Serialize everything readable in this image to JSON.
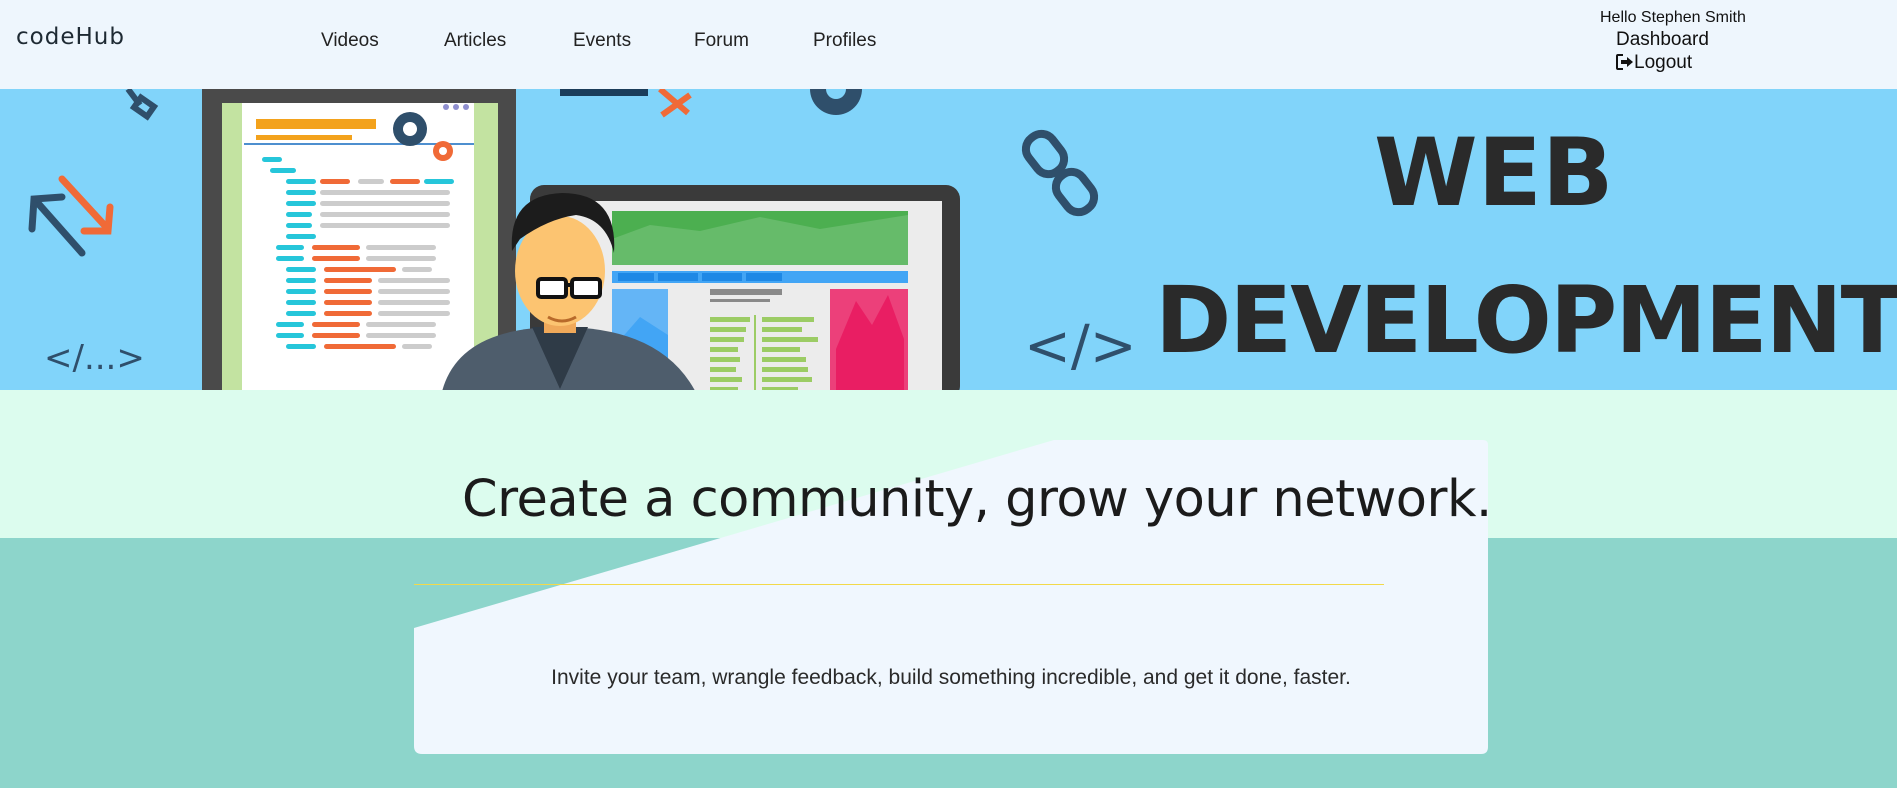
{
  "brand": "codeHub",
  "nav": {
    "videos": "Videos",
    "articles": "Articles",
    "events": "Events",
    "forum": "Forum",
    "profiles": "Profiles"
  },
  "user": {
    "greeting": "Hello Stephen Smith",
    "dashboard": "Dashboard",
    "logout": "Logout",
    "logout_icon": "sign-out-icon"
  },
  "hero": {
    "line1": "WEB",
    "line2": "DEVELOPMENT",
    "tag_left": "</...>",
    "tag_right": "</>"
  },
  "main": {
    "headline": "Create a community, grow your network.",
    "tagline": "Invite your team, wrangle feedback, build something incredible, and get it done, faster."
  },
  "colors": {
    "navbar_bg": "#eef6fd",
    "hero_bg": "#81d4fa",
    "mint": "#dcfcee",
    "teal": "#8dd5cb",
    "card": "#f0f7fe",
    "divider": "#f2d94a"
  }
}
